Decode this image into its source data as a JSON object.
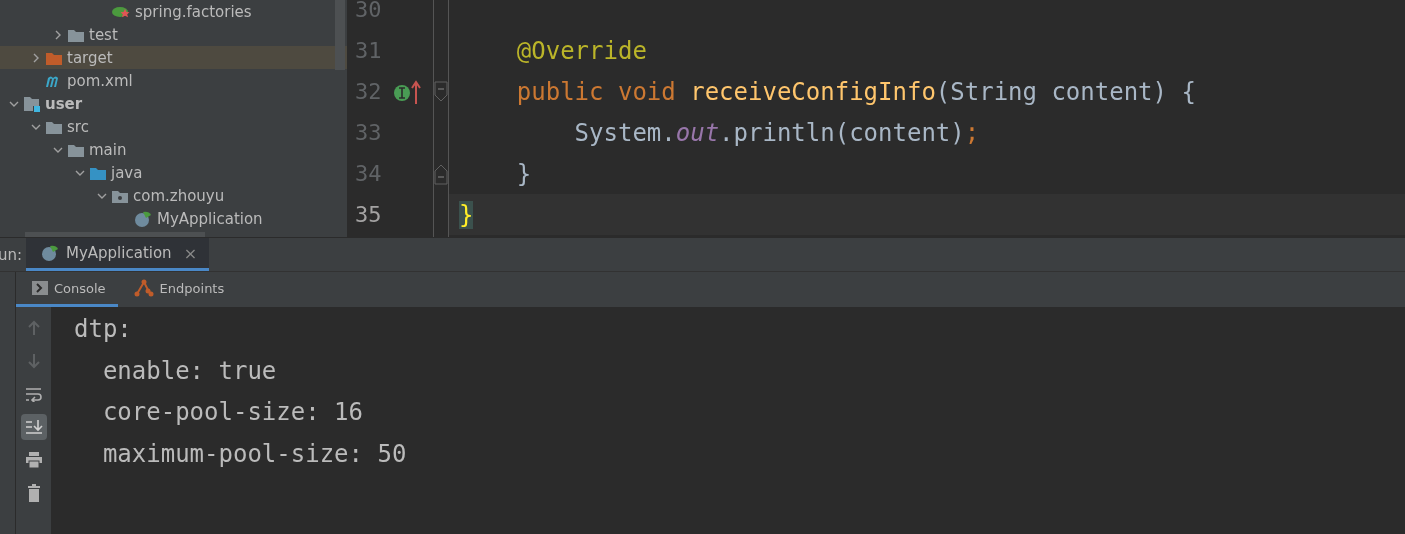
{
  "project_tree": {
    "items": [
      {
        "children": [
          {
            "children": [
              {
                "children": [
                  {
                    "children": [
                      {
                        "label": "spring.factories",
                        "kind": "spring-config",
                        "selected": false
                      }
                    ]
                  }
                ]
              },
              {
                "label": "test",
                "kind": "folder",
                "expanded": false,
                "selected": false
              }
            ]
          },
          {
            "label": "target",
            "kind": "excluded-folder",
            "expanded": false,
            "selected": true
          },
          {
            "label": "pom.xml",
            "kind": "maven",
            "selected": false
          }
        ]
      },
      {
        "label": "user",
        "kind": "module",
        "bold": true,
        "expanded": true,
        "selected": false,
        "children": [
          {
            "label": "src",
            "kind": "folder",
            "expanded": true,
            "selected": false,
            "children": [
              {
                "label": "main",
                "kind": "folder",
                "expanded": true,
                "selected": false,
                "children": [
                  {
                    "label": "java",
                    "kind": "source-folder",
                    "expanded": true,
                    "selected": false,
                    "children": [
                      {
                        "label": "com.zhouyu",
                        "kind": "package",
                        "expanded": true,
                        "selected": false,
                        "children": [
                          {
                            "label": "MyApplication",
                            "kind": "spring-class",
                            "selected": false
                          }
                        ]
                      }
                    ]
                  }
                ]
              }
            ]
          }
        ]
      }
    ]
  },
  "editor": {
    "lines": [
      {
        "number": "30",
        "current": false,
        "kind": "plain"
      },
      {
        "number": "31",
        "current": false,
        "kind": "plain",
        "tokens": [
          {
            "kind": "annotation",
            "text": "    @Override"
          }
        ]
      },
      {
        "number": "32",
        "current": false,
        "kind": "method-start",
        "tokens": [
          {
            "kind": "keyword",
            "text": "    public void "
          },
          {
            "kind": "method",
            "text": "receiveConfigInfo"
          },
          {
            "kind": "plain",
            "text": "(String content) {"
          }
        ]
      },
      {
        "number": "33",
        "current": false,
        "kind": "plain",
        "tokens": [
          {
            "kind": "plain",
            "text": "        System."
          },
          {
            "kind": "field",
            "text": "out"
          },
          {
            "kind": "plain",
            "text": ".println(content)"
          },
          {
            "kind": "keyword",
            "text": ";"
          }
        ]
      },
      {
        "number": "34",
        "current": false,
        "kind": "block-end",
        "tokens": [
          {
            "kind": "plain",
            "text": "    }"
          }
        ]
      },
      {
        "number": "35",
        "current": true,
        "kind": "plain",
        "tokens": [
          {
            "kind": "matched-brace",
            "text": "}"
          }
        ]
      }
    ]
  },
  "run_panel": {
    "label": "un:",
    "tabs": [
      {
        "label": "MyApplication",
        "close": "×",
        "selected": true
      }
    ],
    "tool_tabs": [
      {
        "label": "Console",
        "kind": "console",
        "selected": true
      },
      {
        "label": "Endpoints",
        "kind": "endpoints",
        "selected": false
      }
    ],
    "toolbar": [
      {
        "kind": "up",
        "toggled": false
      },
      {
        "kind": "down",
        "toggled": false
      },
      {
        "kind": "wrap",
        "toggled": false
      },
      {
        "kind": "scroll-end",
        "toggled": true
      },
      {
        "kind": "print",
        "toggled": false
      },
      {
        "kind": "trash",
        "toggled": false
      }
    ],
    "console_lines": [
      "dtp:",
      "  enable: true",
      "  core-pool-size: 16",
      "  maximum-pool-size: 50"
    ]
  }
}
